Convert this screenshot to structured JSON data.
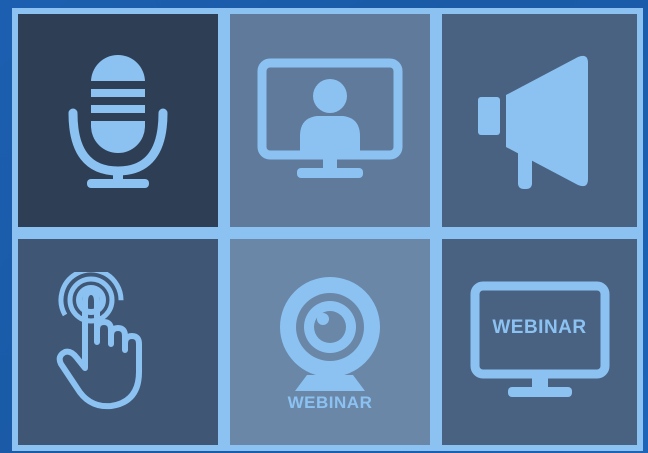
{
  "tiles": [
    {
      "icon": "microphone-icon",
      "color": "#2e3f55"
    },
    {
      "icon": "video-call-monitor-icon",
      "color": "#5f7a9b"
    },
    {
      "icon": "megaphone-icon",
      "color": "#4a6281"
    },
    {
      "icon": "touch-hand-icon",
      "color": "#3f5674"
    },
    {
      "icon": "webcam-icon",
      "color": "#6a87a8",
      "label": "WEBINAR"
    },
    {
      "icon": "webinar-monitor-icon",
      "color": "#4a6281",
      "label": "WEBINAR"
    }
  ],
  "accent_color": "#8cc2f2",
  "background_color": "#1c5fb0"
}
